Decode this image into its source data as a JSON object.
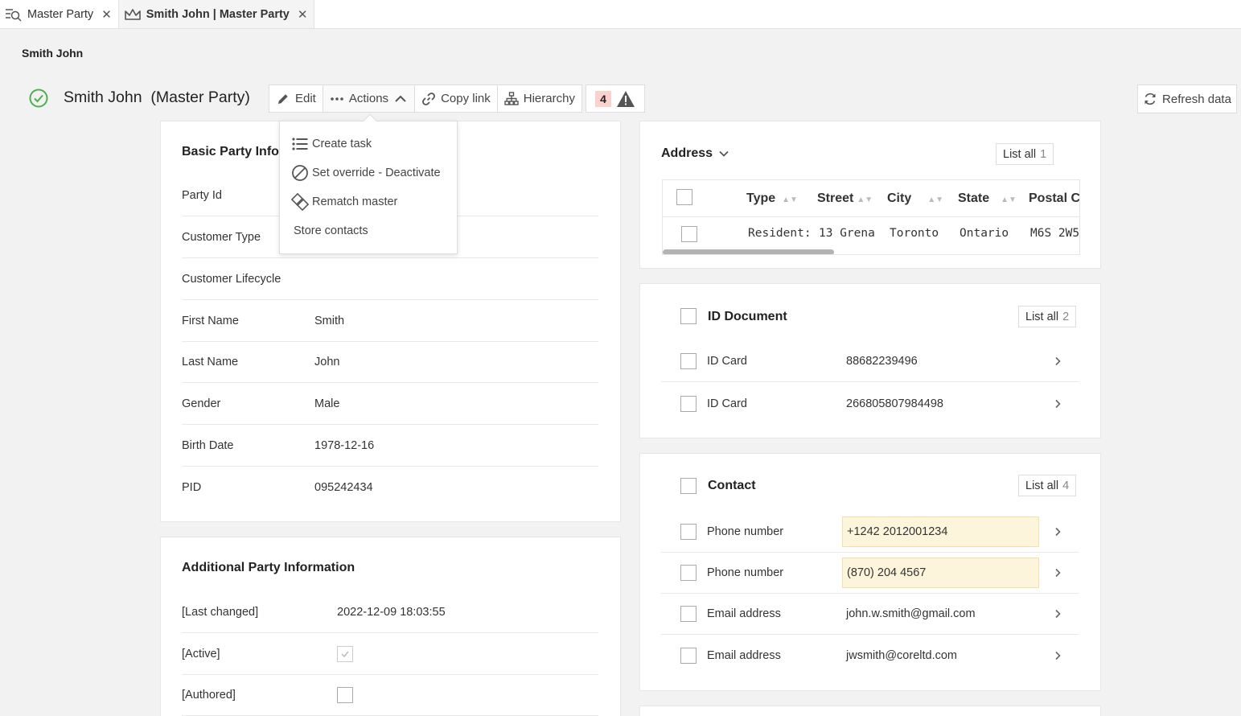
{
  "tabs": [
    {
      "label": "Master Party",
      "icon": "search-list-icon",
      "active": false
    },
    {
      "label": "Smith John | Master Party",
      "icon": "crown-icon",
      "active": true
    }
  ],
  "breadcrumb": "Smith John",
  "header": {
    "title": "Smith John  (Master Party)",
    "status_color": "#4caf50"
  },
  "toolbar": {
    "edit": "Edit",
    "actions": "Actions",
    "copy_link": "Copy link",
    "hierarchy": "Hierarchy",
    "issues_count": "4",
    "refresh": "Refresh data"
  },
  "actions_menu": [
    {
      "label": "Create task",
      "icon": "list-icon"
    },
    {
      "label": "Set override - Deactivate",
      "icon": "forbidden-icon"
    },
    {
      "label": "Rematch master",
      "icon": "rematch-icon"
    },
    {
      "label": "Store contacts",
      "icon": ""
    }
  ],
  "basic_info": {
    "title": "Basic Party Inform",
    "rows": [
      {
        "label": "Party Id",
        "value": ""
      },
      {
        "label": "Customer Type",
        "value": ""
      },
      {
        "label": "Customer Lifecycle",
        "value": ""
      },
      {
        "label": "First Name",
        "value": "Smith"
      },
      {
        "label": "Last Name",
        "value": "John"
      },
      {
        "label": "Gender",
        "value": "Male"
      },
      {
        "label": "Birth Date",
        "value": "1978-12-16"
      },
      {
        "label": "PID",
        "value": "095242434"
      }
    ]
  },
  "additional_info": {
    "title": "Additional Party Information",
    "rows": [
      {
        "label": "[Last changed]",
        "value": "2022-12-09 18:03:55"
      },
      {
        "label": "[Active]",
        "value": "",
        "checked": true
      },
      {
        "label": "[Authored]",
        "value": "",
        "checked": false
      }
    ]
  },
  "address": {
    "title": "Address",
    "list_all": "List all",
    "count": "1",
    "columns": [
      "Type",
      "Street",
      "City",
      "State",
      "Postal Cc"
    ],
    "rows": [
      [
        "Resident:",
        "13 Grena",
        "Toronto",
        "Ontario",
        "M6S 2W5"
      ]
    ]
  },
  "id_document": {
    "title": "ID Document",
    "list_all": "List all",
    "count": "2",
    "rows": [
      {
        "label": "ID Card",
        "value": "88682239496"
      },
      {
        "label": "ID Card",
        "value": "266805807984498"
      }
    ]
  },
  "contact": {
    "title": "Contact",
    "list_all": "List all",
    "count": "4",
    "rows": [
      {
        "label": "Phone number",
        "value": "+1242 2012001234",
        "highlight": true
      },
      {
        "label": "Phone number",
        "value": "(870) 204 4567",
        "highlight": true
      },
      {
        "label": "Email address",
        "value": "john.w.smith@gmail.com",
        "highlight": false
      },
      {
        "label": "Email address",
        "value": "jwsmith@coreltd.com",
        "highlight": false
      }
    ]
  },
  "colors": {
    "highlight_bg": "#fdf4dc",
    "issue_badge": "#fbd1cd",
    "accent_green": "#4caf50"
  }
}
